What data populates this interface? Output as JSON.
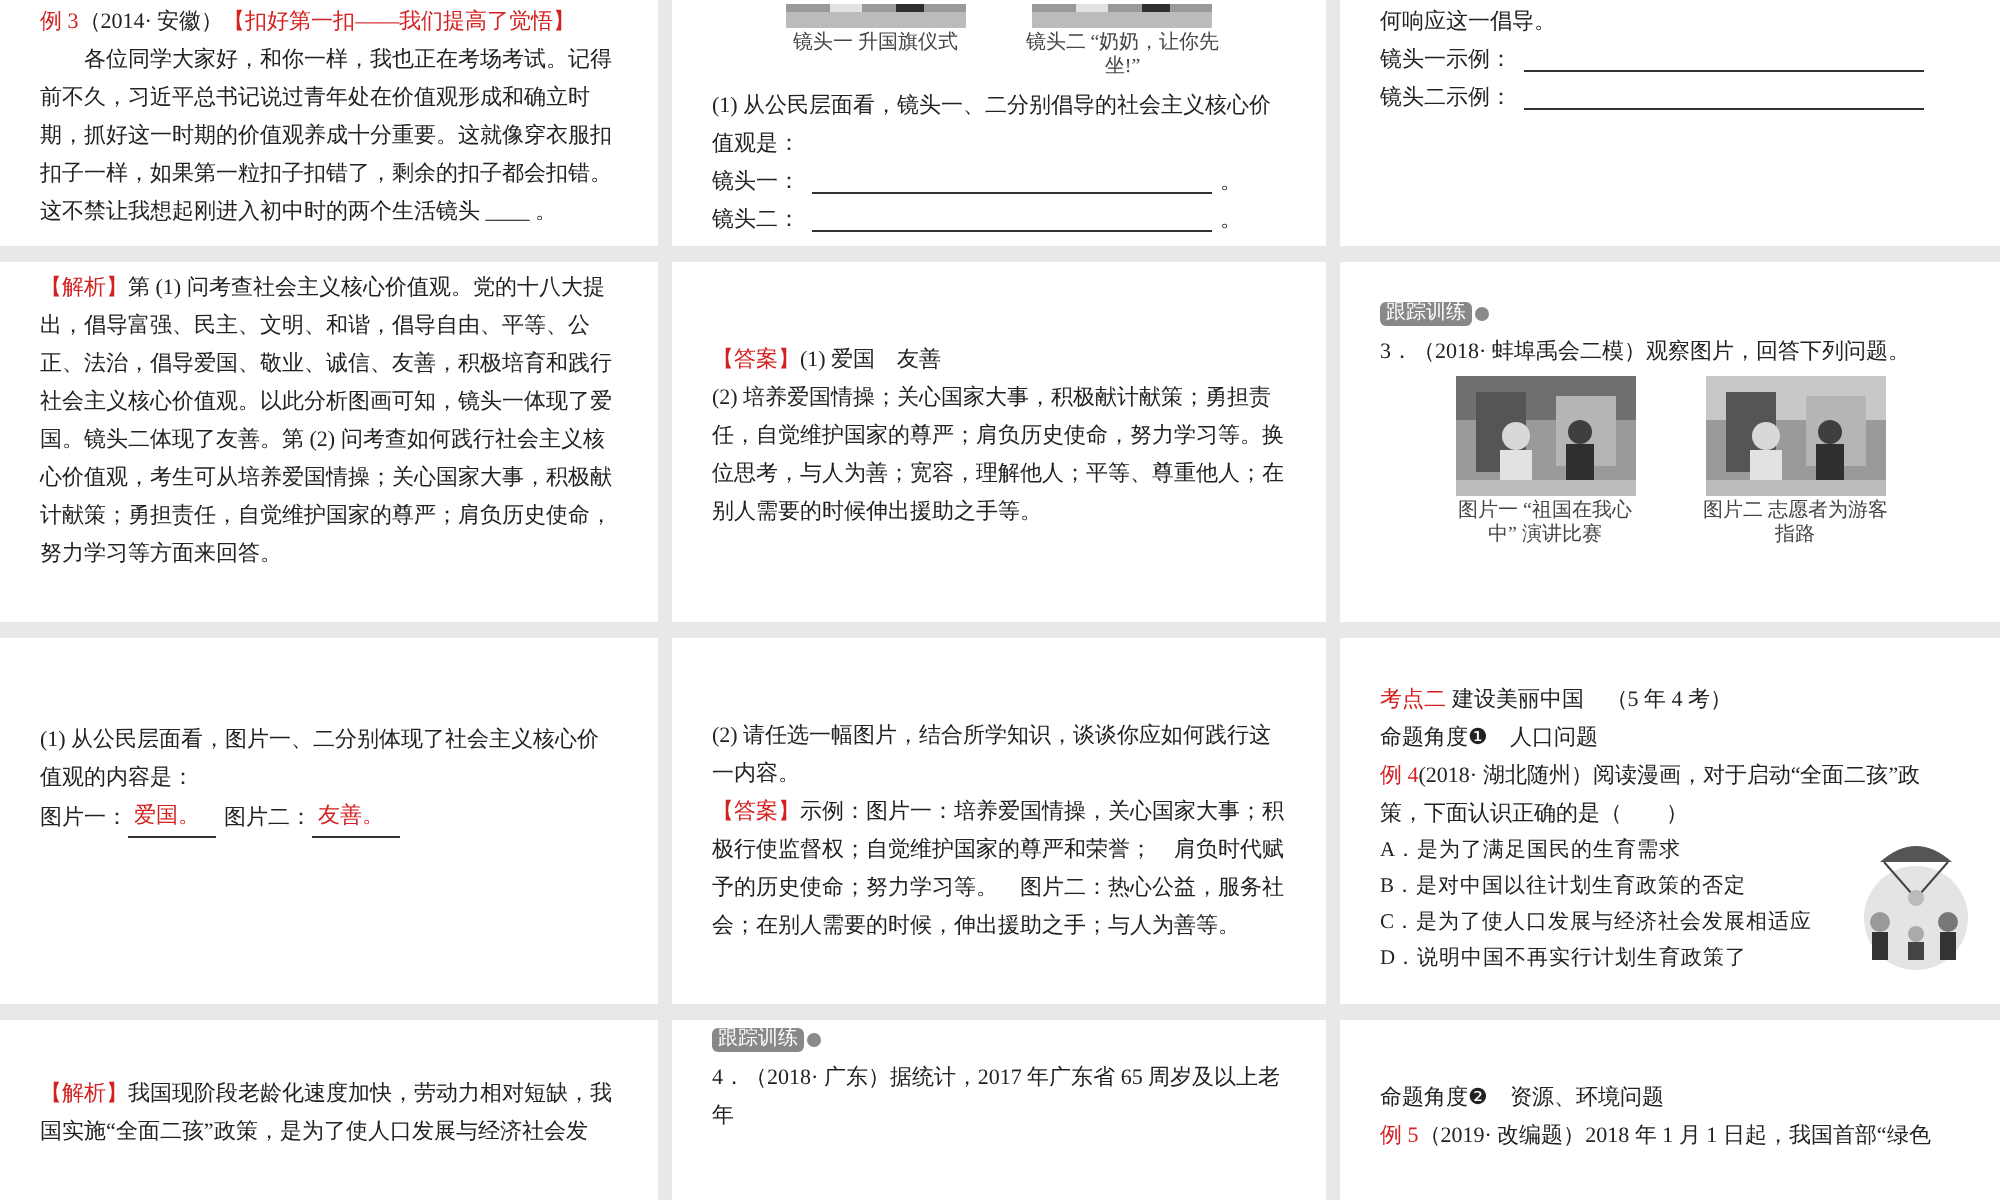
{
  "slides": [
    {
      "blocks": [
        {
          "kind": "paragraph",
          "runs": [
            {
              "text": "例 3",
              "red": true
            },
            {
              "text": "（2014· 安徽）",
              "red": false
            },
            {
              "text": "【扣好第一扣——我们提高了觉悟】",
              "red": true
            }
          ]
        },
        {
          "kind": "paragraph",
          "indent": true,
          "runs": [
            {
              "text": "各位同学大家好，和你一样，我也正在考场考试。记得前不久，习近平总书记说过青年处在价值观形成和确立时期，抓好这一时期的价值观养成十分重要。这就像穿衣服扣扣子一样，如果第一粒扣子扣错了，剩余的扣子都会扣错。这不禁让我想起刚进入初中时的两个生活镜头 ____ 。",
              "red": false
            }
          ]
        }
      ]
    },
    {
      "blocks": [
        {
          "kind": "photos",
          "cut": true,
          "items": [
            {
              "caption": "镜头一 升国旗仪式"
            },
            {
              "caption": "镜头二 “奶奶，让你先坐!”"
            }
          ]
        },
        {
          "kind": "paragraph",
          "indent": false,
          "runs": [
            {
              "text": "(1) 从公民层面看，镜头一、二分别倡导的社会主义核心价值观是：",
              "red": false
            }
          ]
        },
        {
          "kind": "fill-line",
          "label": "镜头一：",
          "end": "。"
        },
        {
          "kind": "fill-line",
          "label": "镜头二：",
          "end": "。"
        }
      ]
    },
    {
      "blocks": [
        {
          "kind": "paragraph",
          "indent": false,
          "runs": [
            {
              "text": "何响应这一倡导。",
              "red": false
            }
          ]
        },
        {
          "kind": "fill-line",
          "label": "镜头一示例："
        },
        {
          "kind": "fill-line",
          "label": "镜头二示例："
        }
      ]
    },
    {
      "blocks": [
        {
          "kind": "paragraph",
          "runs": [
            {
              "text": "【解析】",
              "red": true
            },
            {
              "text": "第 (1) 问考查社会主义核心价值观。党的十八大提出，倡导富强、民主、文明、和谐，倡导自由、平等、公正、法治，倡导爱国、敬业、诚信、友善，积极培育和践行社会主义核心价值观。以此分析图画可知，镜头一体现了爱国。镜头二体现了友善。第 (2) 问考查如何践行社会主义核心价值观，考生可从培养爱国情操；关心国家大事，积极献计献策；勇担责任，自觉维护国家的尊严；肩负历史使命，努力学习等方面来回答。",
              "red": false
            }
          ]
        }
      ]
    },
    {
      "blocks": [
        {
          "kind": "paragraph",
          "indent": false,
          "runs": [
            {
              "text": "【答案】",
              "red": true
            },
            {
              "text": "(1) 爱国　友善",
              "red": false
            }
          ]
        },
        {
          "kind": "paragraph",
          "indent": false,
          "runs": [
            {
              "text": "(2) 培养爱国情操；关心国家大事，积极献计献策；勇担责任，自觉维护国家的尊严；肩负历史使命，努力学习等。换位思考，与人为善；宽容，理解他人；平等、尊重他人；在别人需要的时候伸出援助之手等。",
              "red": false
            }
          ]
        }
      ]
    },
    {
      "blocks": [
        {
          "kind": "tag",
          "label": "跟踪训练"
        },
        {
          "kind": "paragraph",
          "indent": false,
          "runs": [
            {
              "text": "3．（2018· 蚌埠禹会二模）观察图片，回答下列问题。",
              "red": false
            }
          ]
        },
        {
          "kind": "photos",
          "cut": false,
          "items": [
            {
              "caption": "图片一 “祖国在我心中” 演讲比赛"
            },
            {
              "caption": "图片二  志愿者为游客指路"
            }
          ]
        }
      ]
    },
    {
      "blocks": [
        {
          "kind": "paragraph",
          "indent": false,
          "runs": [
            {
              "text": "(1) 从公民层面看，图片一、二分别体现了社会主义核心价值观的内容是：",
              "red": false
            }
          ]
        },
        {
          "kind": "fill-inline",
          "items": [
            {
              "label": "图片一：",
              "value": "爱国。"
            },
            {
              "label": "图片二：",
              "value": "友善。"
            }
          ]
        }
      ]
    },
    {
      "blocks": [
        {
          "kind": "paragraph",
          "indent": false,
          "runs": [
            {
              "text": "(2) 请任选一幅图片，结合所学知识，谈谈你应如何践行这一内容。",
              "red": false
            }
          ]
        },
        {
          "kind": "paragraph",
          "runs": [
            {
              "text": "【答案】",
              "red": true
            },
            {
              "text": "示例：图片一：培养爱国情操，关心国家大事；积极行使监督权；自觉维护国家的尊严和荣誉；　肩负时代赋予的历史使命；努力学习等。　图片二：热心公益，服务社会；在别人需要的时候，伸出援助之手；与人为善等。",
              "red": false
            }
          ]
        }
      ]
    },
    {
      "blocks": [
        {
          "kind": "paragraph",
          "indent": false,
          "runs": [
            {
              "text": "考点二",
              "red": true
            },
            {
              "text": " 建设美丽中国　（5 年 4 考）",
              "red": false
            }
          ]
        },
        {
          "kind": "paragraph",
          "indent": false,
          "runs": [
            {
              "text": "命题角度❶　人口问题",
              "red": false
            }
          ]
        },
        {
          "kind": "paragraph",
          "runs": [
            {
              "text": "例 4",
              "red": true
            },
            {
              "text": "(2018· 湖北随州）阅读漫画，对于启动“全面二孩”政策，下面认识正确的是（　　）",
              "red": false
            }
          ]
        },
        {
          "kind": "cartoon"
        },
        {
          "kind": "option",
          "runs": [
            {
              "text": "A．是为了满足国民的生育需求",
              "red": false
            }
          ]
        },
        {
          "kind": "option",
          "runs": [
            {
              "text": "B．是对中国以往计划生育政策的否定",
              "red": false
            }
          ]
        },
        {
          "kind": "option",
          "runs": [
            {
              "text": "C．是为了使人口发展与经济社会发展相适应",
              "red": false
            }
          ]
        },
        {
          "kind": "option",
          "runs": [
            {
              "text": "D．说明中国不再实行计划生育政策了",
              "red": false
            }
          ]
        }
      ]
    },
    {
      "blocks": [
        {
          "kind": "paragraph",
          "runs": [
            {
              "text": "【解析】",
              "red": true
            },
            {
              "text": "我国现阶段老龄化速度加快，劳动力相对短缺，我国实施“全面二孩”政策，是为了使人口发展与经济社会发",
              "red": false
            }
          ]
        }
      ]
    },
    {
      "blocks": [
        {
          "kind": "tag",
          "label": "跟踪训练"
        },
        {
          "kind": "paragraph",
          "indent": false,
          "runs": [
            {
              "text": "4．（2018· 广东）据统计，2017 年广东省 65 周岁及以上老年",
              "red": false
            }
          ]
        }
      ]
    },
    {
      "blocks": [
        {
          "kind": "paragraph",
          "indent": false,
          "runs": [
            {
              "text": "命题角度❷　资源、环境问题",
              "red": false
            }
          ]
        },
        {
          "kind": "paragraph",
          "indent": false,
          "runs": [
            {
              "text": "例 5",
              "red": true
            },
            {
              "text": "（2019· 改编题）2018 年 1 月 1 日起，我国首部“绿色",
              "red": false
            }
          ]
        }
      ]
    }
  ]
}
